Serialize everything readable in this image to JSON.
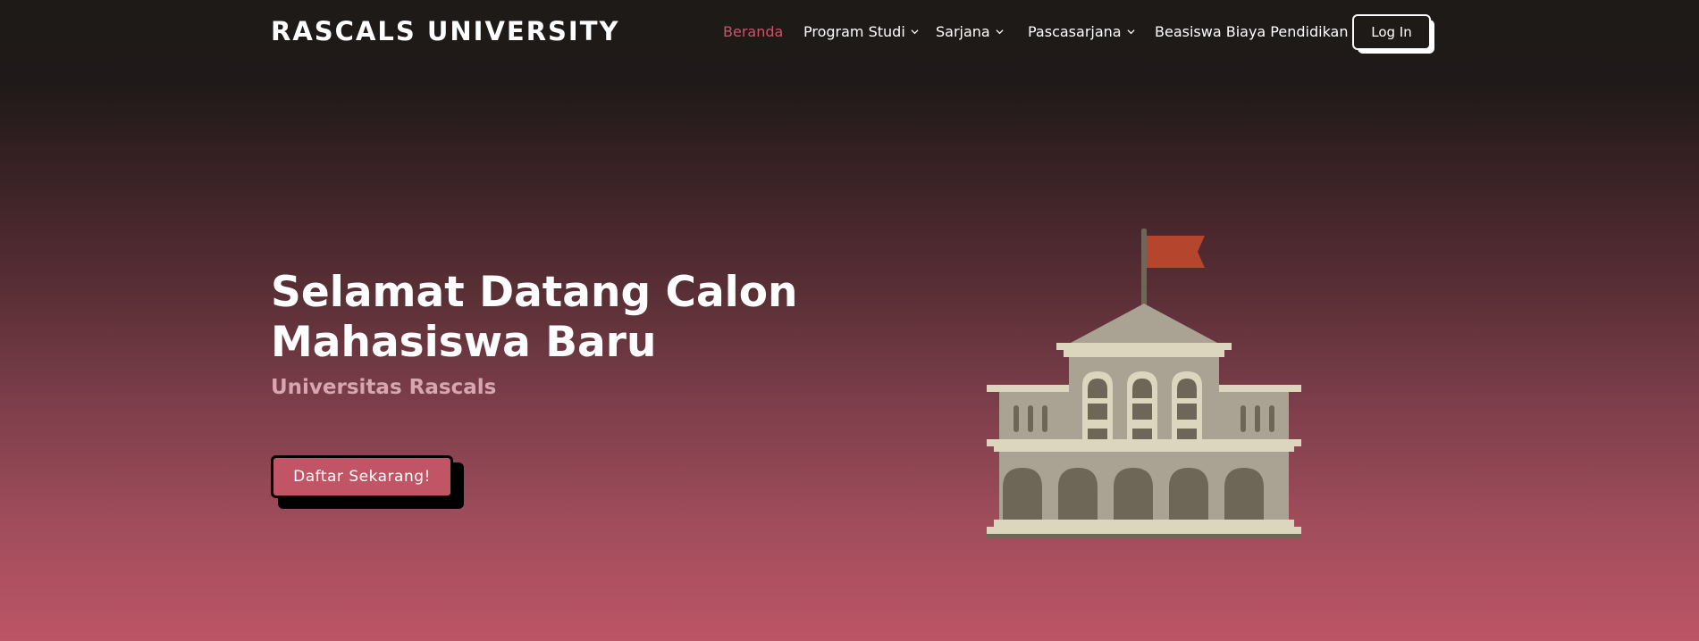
{
  "navbar": {
    "brand": "RASCALS UNIVERSITY",
    "links": [
      {
        "label": "Beranda",
        "active": true
      },
      {
        "label": "Program Studi",
        "dropdown": true
      },
      {
        "label": "Sarjana",
        "dropdown": true
      },
      {
        "label": "Pascasarjana",
        "dropdown": true
      },
      {
        "label": "Beasiswa Biaya Pendidikan"
      }
    ],
    "login_label": "Log In"
  },
  "hero": {
    "title_line1": "Selamat Datang Calon",
    "title_line2": "Mahasiswa Baru",
    "subtitle": "Universitas Rascals",
    "cta_label": "Daftar Sekarang!"
  },
  "illustration": {
    "icon": "university-building-icon",
    "flag_color": "#b5452c",
    "wall_color": "#aaa394",
    "trim_color": "#ddd6bf",
    "window_color": "#6e6657"
  },
  "colors": {
    "accent": "#c15566",
    "active_link": "#c8546a",
    "top_bg": "#1e1a18",
    "bottom_bg": "#bc5566"
  }
}
